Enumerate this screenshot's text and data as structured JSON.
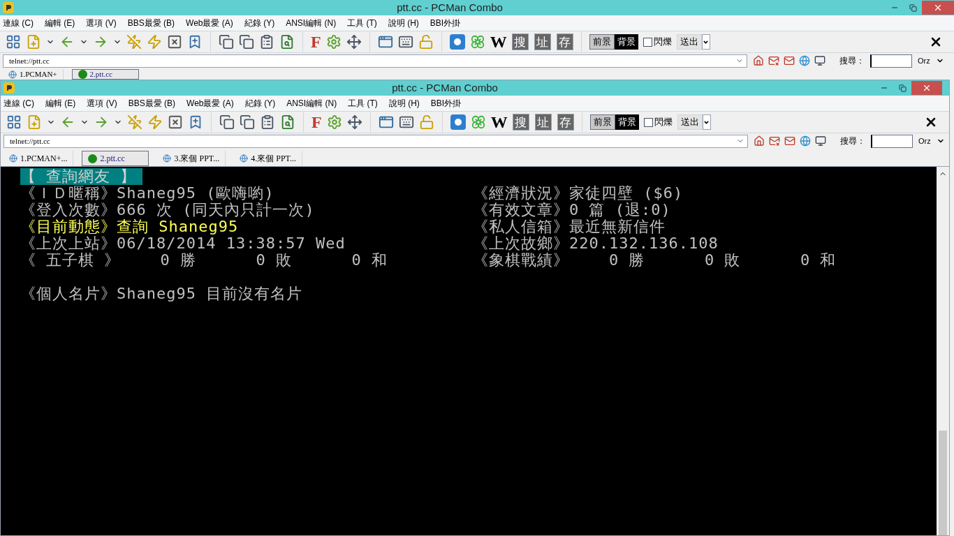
{
  "back_window": {
    "title": "ptt.cc - PCMan Combo",
    "menu": [
      "連線 (C)",
      "編輯 (E)",
      "選項 (V)",
      "BBS最愛 (B)",
      "Web最愛 (A)",
      "紀錄 (Y)",
      "ANSI編輯 (N)",
      "工具 (T)",
      "說明 (H)",
      "BBI外掛"
    ],
    "toolbar": {
      "f_glyph": "F",
      "w_glyph": "W",
      "quick_buttons": [
        "搜",
        "址",
        "存"
      ],
      "foreground": "前景",
      "background": "背景",
      "blink": {
        "label": "閃爍",
        "checked": false
      },
      "send": "送出"
    },
    "address": "telnet://ptt.cc",
    "search_label": "搜尋：",
    "search_engine": "Orz",
    "tabs": [
      {
        "label": "1.PCMAN+",
        "selected": false,
        "kind": "page"
      },
      {
        "label": "2.ptt.cc",
        "selected": true,
        "kind": "connected"
      }
    ]
  },
  "front_window": {
    "title": "ptt.cc - PCMan Combo",
    "menu": [
      "連線 (C)",
      "編輯 (E)",
      "選項 (V)",
      "BBS最愛 (B)",
      "Web最愛 (A)",
      "紀錄 (Y)",
      "ANSI編輯 (N)",
      "工具 (T)",
      "說明 (H)",
      "BBI外掛"
    ],
    "toolbar": {
      "f_glyph": "F",
      "w_glyph": "W",
      "quick_buttons": [
        "搜",
        "址",
        "存"
      ],
      "foreground": "前景",
      "background": "背景",
      "blink": {
        "label": "閃爍",
        "checked": false
      },
      "send": "送出"
    },
    "address": "telnet://ptt.cc",
    "search_label": "搜尋：",
    "search_engine": "Orz",
    "tabs": [
      {
        "label": "1.PCMAN+...",
        "selected": false,
        "kind": "page"
      },
      {
        "label": "2.ptt.cc",
        "selected": true,
        "kind": "connected"
      },
      {
        "label": "3.來個 PPT...",
        "selected": false,
        "kind": "page"
      },
      {
        "label": "4.來個 PPT...",
        "selected": false,
        "kind": "page"
      }
    ],
    "terminal": {
      "header": "【 查詢網友 】",
      "rows": [
        {
          "left": {
            "label": "《ＩＤ暱稱》",
            "value": "Shaneg95 (歐嗨喲)",
            "highlighted": false
          },
          "right": {
            "label": "《經濟狀況》",
            "value": "家徒四壁 ($6)",
            "highlighted": false
          }
        },
        {
          "left": {
            "label": "《登入次數》",
            "value": "666 次 (同天內只計一次)",
            "highlighted": false
          },
          "right": {
            "label": "《有效文章》",
            "value": "0 篇 (退:0)",
            "highlighted": false
          }
        },
        {
          "left": {
            "label": "《目前動態》",
            "value": "查詢 Shaneg95",
            "highlighted": true
          },
          "right": {
            "label": "《私人信箱》",
            "value": "最近無新信件",
            "highlighted": false
          }
        },
        {
          "left": {
            "label": "《上次上站》",
            "value": "06/18/2014 13:38:57 Wed",
            "highlighted": false
          },
          "right": {
            "label": "《上次故鄉》",
            "value": "220.132.136.108",
            "highlighted": false
          }
        },
        {
          "left": {
            "label": "《 五子棋 》",
            "value": "    0 勝      0 敗      0 和",
            "highlighted": false
          },
          "right": {
            "label": "《象棋戰績》",
            "value": "    0 勝      0 敗      0 和",
            "highlighted": false
          }
        }
      ],
      "card": {
        "label": "《個人名片》",
        "value": "Shaneg95 目前沒有名片"
      }
    }
  }
}
